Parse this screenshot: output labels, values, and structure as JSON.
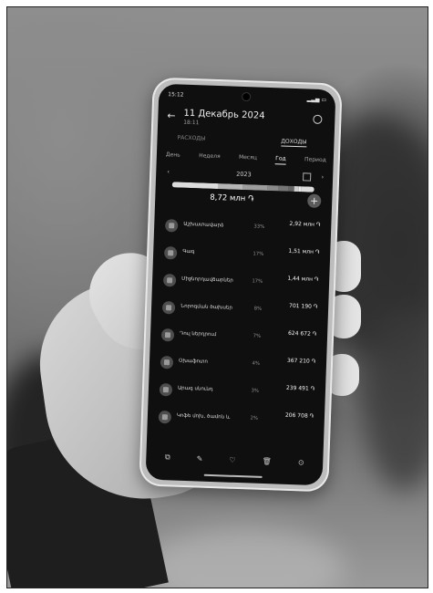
{
  "status": {
    "time": "15:12",
    "battery": ""
  },
  "header": {
    "date": "11 Декабрь 2024",
    "time": "18:11"
  },
  "tabs": {
    "expenses": "РАСХОДЫ",
    "income": "ДОХОДЫ"
  },
  "periods": [
    "День",
    "Неделя",
    "Месяц",
    "Год",
    "Период"
  ],
  "active_period_index": 3,
  "year": "2023",
  "total": "8,72 млн ֏",
  "colors": {
    "bar": [
      "#dcdcdc",
      "#b6b6b6",
      "#9d9d9d",
      "#8a8a8a",
      "#767676",
      "#666666",
      "#cfcfcf",
      "#e8e8e8"
    ]
  },
  "items": [
    {
      "name": "Աշխատավարձ",
      "percent": "33%",
      "amount": "2,92 млн ֏",
      "prev": ""
    },
    {
      "name": "Գագ",
      "percent": "17%",
      "amount": "1,51 млн ֏",
      "prev": ""
    },
    {
      "name": "Միջնորդավճարներ",
      "percent": "17%",
      "amount": "1,44 млн ֏",
      "prev": ""
    },
    {
      "name": "Նորոգման ծախսեր",
      "percent": "8%",
      "amount": "701 190 ֏",
      "prev": ""
    },
    {
      "name": "Դուլ ներդրում",
      "percent": "7%",
      "amount": "624 672 ֏",
      "prev": ""
    },
    {
      "name": "Օխաֆոտո",
      "percent": "4%",
      "amount": "367 210 ֏",
      "prev": ""
    },
    {
      "name": "Արագ սնունդ",
      "percent": "3%",
      "amount": "239 491 ֏",
      "prev": ""
    },
    {
      "name": "Կոֆե մոխ, ծամոն և",
      "percent": "2%",
      "amount": "206 708 ֏",
      "prev": ""
    }
  ],
  "bar_segments": [
    33,
    17,
    17,
    8,
    7,
    4,
    3,
    2,
    9
  ],
  "bottom_icons": [
    "edit-icon",
    "pen-icon",
    "heart-icon",
    "trash-icon",
    "more-icon"
  ]
}
